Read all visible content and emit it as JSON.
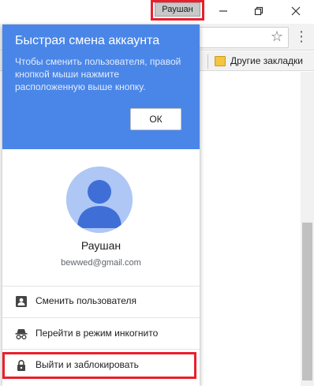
{
  "titlebar": {
    "profile_button_label": "Раушан",
    "minimize_icon": "minimize-icon",
    "restore_icon": "restore-icon",
    "close_icon": "close-icon"
  },
  "toolbar": {
    "star_icon": "star-icon",
    "menu_icon": "vertical-dots-menu-icon"
  },
  "bookmarks": {
    "other_bookmarks_label": "Другие закладки"
  },
  "popup": {
    "promo": {
      "title": "Быстрая смена аккаунта",
      "text": "Чтобы сменить пользователя, правой кнопкой мыши нажмите расположенную выше кнопку.",
      "ok_label": "ОК",
      "background_color": "#4a86e8"
    },
    "user": {
      "name": "Раушан",
      "email": "bewwed@gmail.com",
      "avatar_icon": "person-avatar-icon"
    },
    "menu": [
      {
        "label": "Сменить пользователя",
        "icon": "switch-user-icon"
      },
      {
        "label": "Перейти в режим инкогнито",
        "icon": "incognito-icon"
      },
      {
        "label": "Выйти и заблокировать",
        "icon": "lock-icon"
      }
    ]
  },
  "highlight_color": "#e8202d"
}
